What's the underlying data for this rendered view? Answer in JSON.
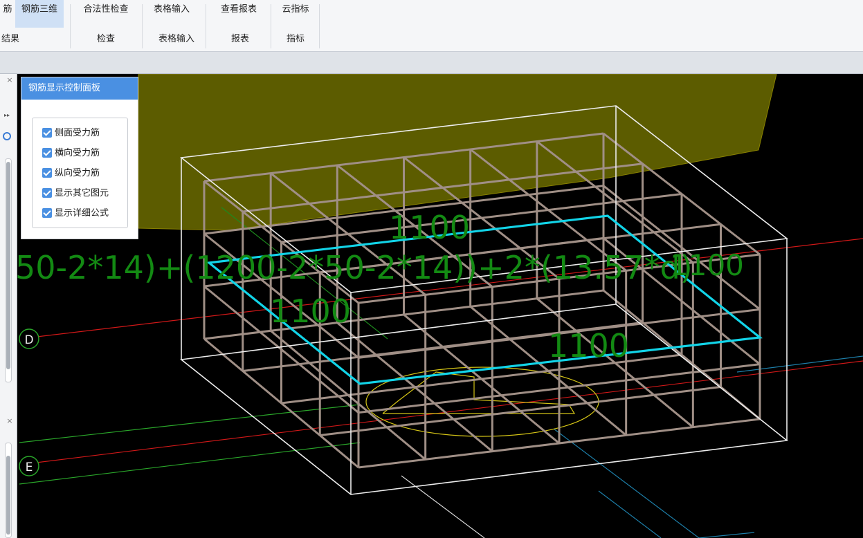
{
  "ribbon": {
    "buttons": [
      "筋",
      "钢筋三维",
      "合法性检查",
      "表格输入",
      "查看报表",
      "云指标"
    ],
    "groups": [
      "结果",
      "检查",
      "表格输入",
      "报表",
      "指标"
    ]
  },
  "left_panel": {
    "close_icon": "×",
    "expand_icon": "▸▸"
  },
  "control_panel": {
    "title": "钢筋显示控制面板",
    "options": [
      "侧面受力筋",
      "横向受力筋",
      "纵向受力筋",
      "显示其它图元",
      "显示详细公式"
    ]
  },
  "viewport": {
    "formula": "50-2*14)+(1200-2*50-2*14))+2*(13.57*d)",
    "overlay_text": "1100",
    "dim_labels": [
      "1100",
      "1100",
      "1100"
    ],
    "axis_labels": [
      "D",
      "E"
    ]
  }
}
